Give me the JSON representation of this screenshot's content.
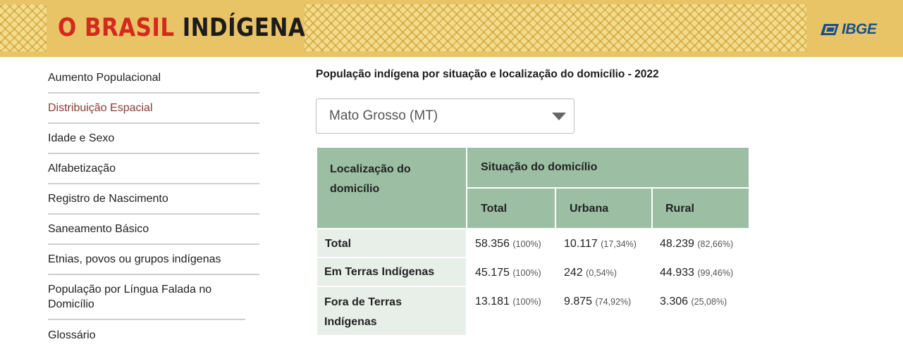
{
  "banner": {
    "title_part1": "O BRASIL ",
    "title_part2": "INDÍGENA",
    "brand": "IBGE",
    "colors": {
      "banner": "#e8c466",
      "title_red": "#d42a1d",
      "brand_blue": "#1a4f8f"
    }
  },
  "sidebar": {
    "items": [
      {
        "label": "Aumento Populacional",
        "active": false
      },
      {
        "label": "Distribuição Espacial",
        "active": true
      },
      {
        "label": "Idade e Sexo",
        "active": false
      },
      {
        "label": "Alfabetização",
        "active": false
      },
      {
        "label": "Registro de Nascimento",
        "active": false
      },
      {
        "label": "Saneamento Básico",
        "active": false
      },
      {
        "label": "Etnias, povos ou grupos indígenas",
        "active": false
      },
      {
        "label": "População por Língua Falada no Domicílio",
        "active": false
      },
      {
        "label": "Glossário",
        "active": false
      }
    ]
  },
  "main": {
    "title": "População indígena por situação e localização do domicílio - 2022",
    "select": {
      "value": "Mato Grosso (MT)"
    },
    "table": {
      "corner_header": "Localização do domicílio",
      "group_header": "Situação do domicílio",
      "columns": [
        "Total",
        "Urbana",
        "Rural"
      ],
      "rows": [
        {
          "label": "Total",
          "cells": [
            {
              "value": "58.356",
              "pct": "(100%)"
            },
            {
              "value": "10.117",
              "pct": "(17,34%)"
            },
            {
              "value": "48.239",
              "pct": "(82,66%)"
            }
          ]
        },
        {
          "label": "Em Terras Indígenas",
          "cells": [
            {
              "value": "45.175",
              "pct": "(100%)"
            },
            {
              "value": "242",
              "pct": "(0,54%)"
            },
            {
              "value": "44.933",
              "pct": "(99,46%)"
            }
          ]
        },
        {
          "label": "Fora de Terras Indígenas",
          "cells": [
            {
              "value": "13.181",
              "pct": "(100%)"
            },
            {
              "value": "9.875",
              "pct": "(74,92%)"
            },
            {
              "value": "3.306",
              "pct": "(25,08%)"
            }
          ]
        }
      ]
    }
  }
}
